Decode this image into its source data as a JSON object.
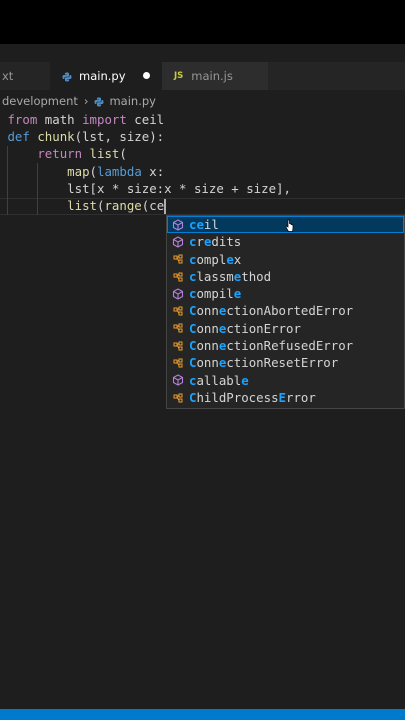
{
  "tabs": [
    {
      "label": "xt",
      "icon": "text-file-icon",
      "active": false
    },
    {
      "label": "main.py",
      "icon": "python-icon",
      "active": true,
      "modified": true
    },
    {
      "label": "main.js",
      "icon": "javascript-icon",
      "active": false
    }
  ],
  "js_badge": "JS",
  "breadcrumb": {
    "folder": "development",
    "separator": "›",
    "file": "main.py"
  },
  "code": {
    "line1": {
      "kw1": "from",
      "mod": " math ",
      "kw2": "import",
      "name": " ceil"
    },
    "line2": {
      "kw": "def",
      "fn": " chunk",
      "rest": "(lst, size):"
    },
    "line3": {
      "indent": "    ",
      "kw": "return",
      "fn": " list",
      "rest": "("
    },
    "line4": {
      "indent": "        ",
      "fn": "map",
      "open": "(",
      "kw": "lambda",
      "rest": " x:"
    },
    "line5": {
      "indent": "        ",
      "text": "lst[x * size:x * size + size],"
    },
    "line6": {
      "indent": "        ",
      "fn1": "list",
      "p1": "(",
      "fn2": "range",
      "p2": "(",
      "typed": "ce"
    }
  },
  "suggestions": [
    {
      "pre": "",
      "hl": "ce",
      "post": "il",
      "icon": "cube-icon",
      "kind": "function"
    },
    {
      "pre": "",
      "hl": "c",
      "mid": "r",
      "hl2": "e",
      "post": "dits",
      "icon": "cube-icon",
      "kind": "function"
    },
    {
      "pre": "",
      "hl": "c",
      "mid": "ompl",
      "hl2": "e",
      "post": "x",
      "icon": "class-icon",
      "kind": "class"
    },
    {
      "pre": "",
      "hl": "c",
      "mid": "lassm",
      "hl2": "e",
      "post": "thod",
      "icon": "class-icon",
      "kind": "class"
    },
    {
      "pre": "",
      "hl": "c",
      "mid": "ompil",
      "hl2": "e",
      "post": "",
      "icon": "cube-icon",
      "kind": "function"
    },
    {
      "pre": "",
      "hl": "C",
      "mid": "onn",
      "hl2": "e",
      "post": "ctionAbortedError",
      "icon": "class-icon",
      "kind": "class"
    },
    {
      "pre": "",
      "hl": "C",
      "mid": "onn",
      "hl2": "e",
      "post": "ctionError",
      "icon": "class-icon",
      "kind": "class"
    },
    {
      "pre": "",
      "hl": "C",
      "mid": "onn",
      "hl2": "e",
      "post": "ctionRefusedError",
      "icon": "class-icon",
      "kind": "class"
    },
    {
      "pre": "",
      "hl": "C",
      "mid": "onn",
      "hl2": "e",
      "post": "ctionResetError",
      "icon": "class-icon",
      "kind": "class"
    },
    {
      "pre": "",
      "hl": "c",
      "mid": "allabl",
      "hl2": "e",
      "post": "",
      "icon": "cube-icon",
      "kind": "function"
    },
    {
      "pre": "",
      "hl": "C",
      "mid": "hildProcess",
      "hl2": "E",
      "post": "rror",
      "icon": "class-icon",
      "kind": "class"
    }
  ],
  "colors": {
    "accent": "#007acc",
    "keyword": "#c586c0",
    "function": "#dcdcaa",
    "match": "#18a3ff"
  }
}
